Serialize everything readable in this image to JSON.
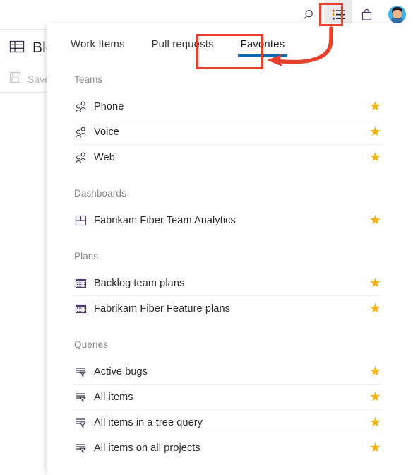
{
  "topbar": {
    "icons": [
      {
        "name": "search-icon",
        "label": "Search"
      },
      {
        "name": "work-items-icon",
        "label": "Work items"
      },
      {
        "name": "marketplace-icon",
        "label": "Marketplace"
      },
      {
        "name": "user-avatar",
        "label": "User profile"
      }
    ]
  },
  "background": {
    "page_title": "Blo",
    "page_title_icon": "table-icon",
    "save_label": "Save",
    "save_icon": "save-icon"
  },
  "flyout": {
    "tabs": [
      {
        "label": "Work Items",
        "selected": false
      },
      {
        "label": "Pull requests",
        "selected": false
      },
      {
        "label": "Favorites",
        "selected": true
      }
    ],
    "accent_color": "#0b6ab0",
    "star_color": "#f2b31a",
    "groups": [
      {
        "title": "Teams",
        "items": [
          {
            "label": "Phone",
            "icon": "people-icon",
            "favorited": true
          },
          {
            "label": "Voice",
            "icon": "people-icon",
            "favorited": true
          },
          {
            "label": "Web",
            "icon": "people-icon",
            "favorited": true
          }
        ]
      },
      {
        "title": "Dashboards",
        "items": [
          {
            "label": "Fabrikam Fiber Team Analytics",
            "icon": "dashboard-icon",
            "favorited": true
          }
        ]
      },
      {
        "title": "Plans",
        "items": [
          {
            "label": "Backlog team plans",
            "icon": "plan-icon",
            "favorited": true
          },
          {
            "label": "Fabrikam Fiber Feature plans",
            "icon": "plan-icon",
            "favorited": true
          }
        ]
      },
      {
        "title": "Queries",
        "items": [
          {
            "label": "Active bugs",
            "icon": "query-icon",
            "favorited": true
          },
          {
            "label": "All items",
            "icon": "query-icon",
            "favorited": true
          },
          {
            "label": "All items in a tree query",
            "icon": "query-icon",
            "favorited": true
          },
          {
            "label": "All items on all projects",
            "icon": "query-icon",
            "favorited": true
          }
        ]
      }
    ]
  },
  "annotations": {
    "color": "#e8402a",
    "highlight_icon": "work-items-icon",
    "highlight_tab": "Favorites",
    "arrow": "curved-arrow-pointing-left"
  },
  "star_glyph": "★"
}
